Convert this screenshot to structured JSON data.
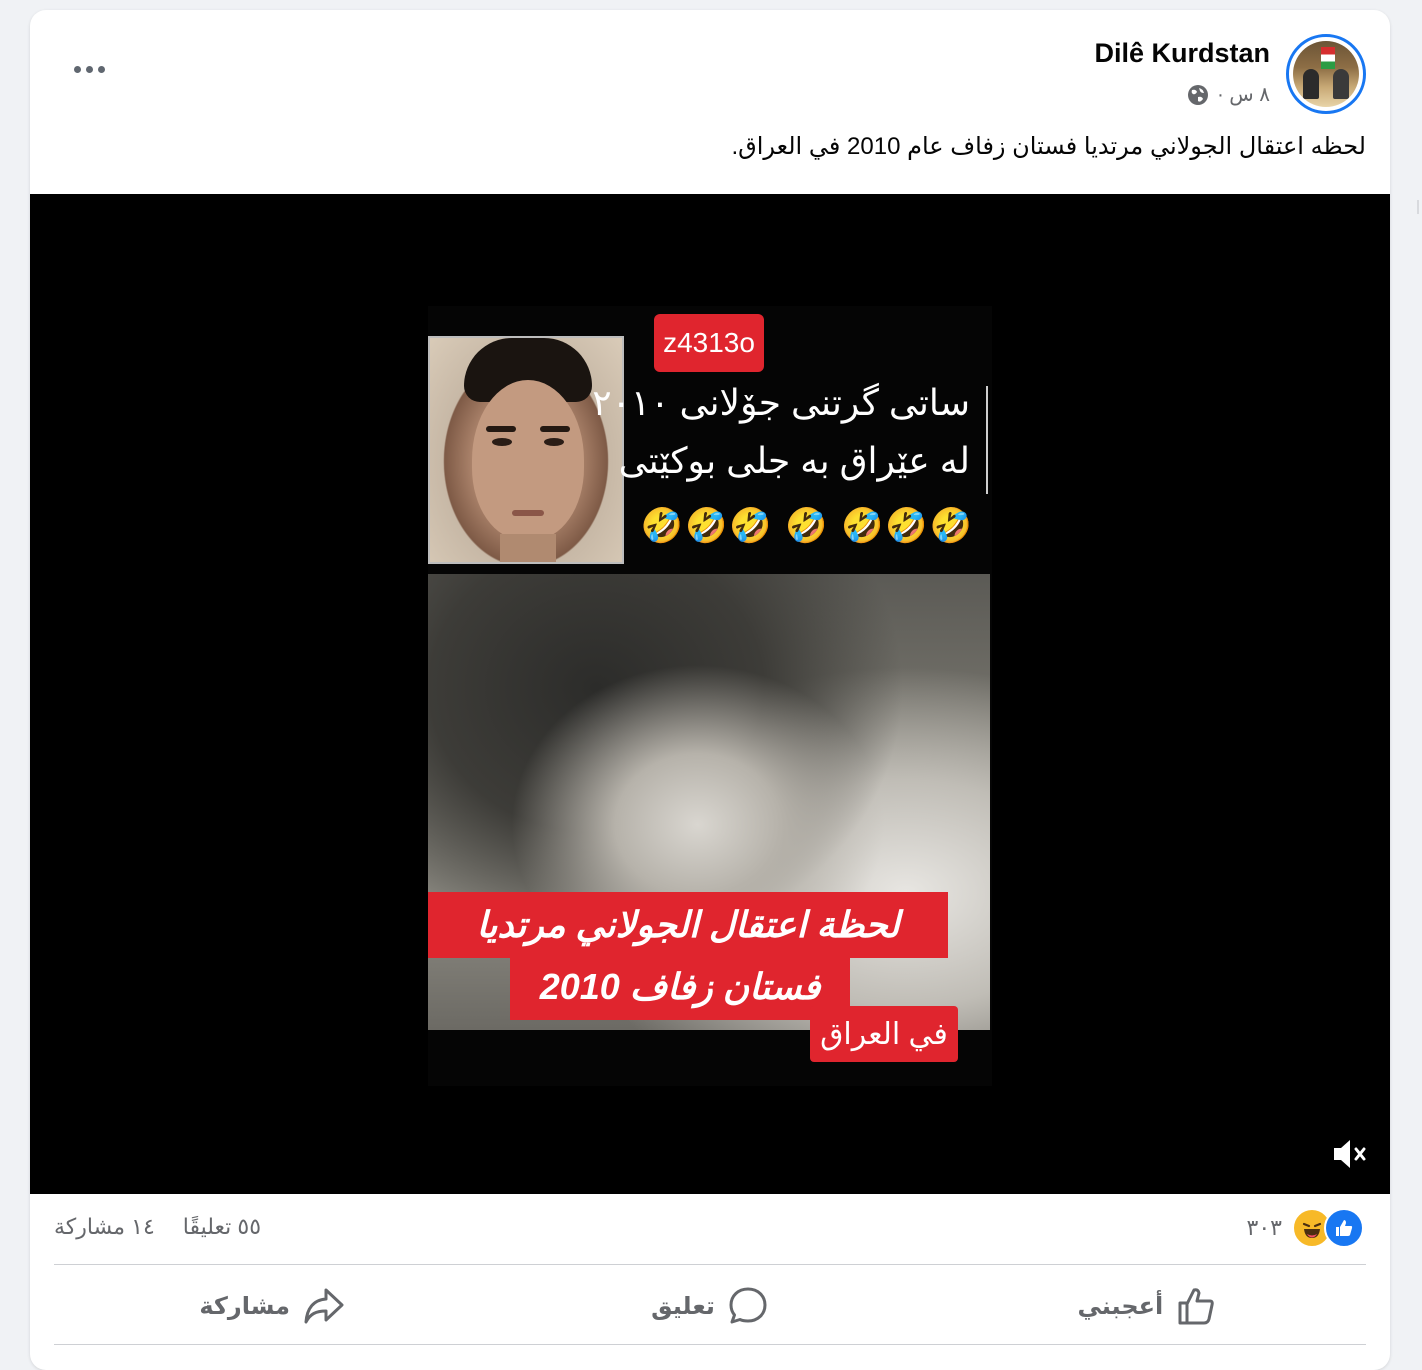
{
  "post": {
    "author": "Dilê Kurdstan",
    "time": "٨ س ·",
    "caption": "لحظه اعتقال الجولاني مرتديا فستان زفاف عام 2010 في العراق."
  },
  "video": {
    "code_badge": "z4313o",
    "kurdish_line1": "ساتی گرتنی جۆلانی ٢٠١٠",
    "kurdish_line2": "له عێراق به جلی بوکێتی",
    "emojis": "🤣🤣🤣 🤣 🤣🤣🤣",
    "red_line1": "لحظة اعتقال الجولاني مرتديا",
    "red_line2": "فستان زفاف 2010",
    "red_line3": "في العراق"
  },
  "stats": {
    "reactions_count": "٣٠٣",
    "comments": "٥٥ تعليقًا",
    "shares": "١٤ مشاركة"
  },
  "actions": {
    "like": "أعجبني",
    "comment": "تعليق",
    "share": "مشاركة"
  },
  "icons": {
    "more": "more-options-icon",
    "globe": "globe-icon",
    "mute": "muted-speaker-icon",
    "like": "thumbs-up-icon",
    "comment": "comment-bubble-icon",
    "share": "share-arrow-icon"
  },
  "colors": {
    "accent": "#1877f2",
    "red_banner": "#e0252e",
    "secondary_text": "#65676b"
  }
}
